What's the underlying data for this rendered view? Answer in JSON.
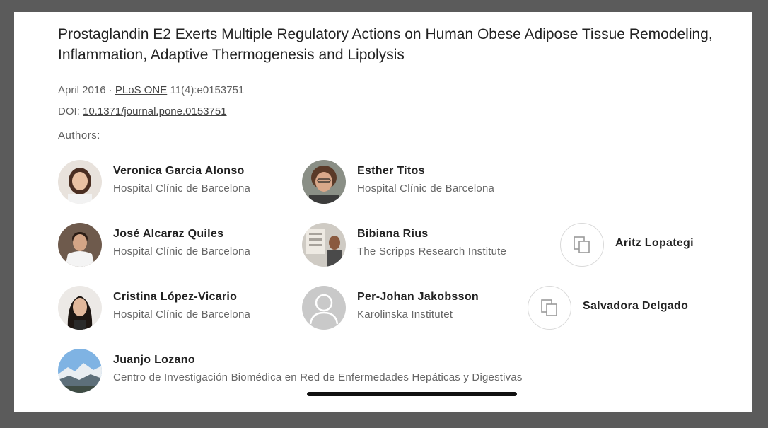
{
  "paper": {
    "title": "Prostaglandin E2 Exerts Multiple Regulatory Actions on Human Obese Adipose Tissue Remodeling, Inflammation, Adaptive Thermogenesis and Lipolysis",
    "date": "April 2016",
    "separator": "·",
    "journal": "PLoS ONE",
    "volume": "11(4):e0153751",
    "doi_label": "DOI:",
    "doi": "10.1371/journal.pone.0153751",
    "authors_label": "Authors:"
  },
  "authors": [
    {
      "name": "Veronica Garcia Alonso",
      "institution": "Hospital Clínic de Barcelona",
      "avatar": "photo"
    },
    {
      "name": "Esther Titos",
      "institution": "Hospital Clínic de Barcelona",
      "avatar": "photo"
    },
    {
      "name": "José Alcaraz Quiles",
      "institution": "Hospital Clínic de Barcelona",
      "avatar": "photo"
    },
    {
      "name": "Bibiana Rius",
      "institution": "The Scripps Research Institute",
      "avatar": "photo"
    },
    {
      "name": "Aritz Lopategi",
      "institution": "",
      "avatar": "copy-icon"
    },
    {
      "name": "Cristina López-Vicario",
      "institution": "Hospital Clínic de Barcelona",
      "avatar": "photo"
    },
    {
      "name": "Per-Johan Jakobsson",
      "institution": "Karolinska Institutet",
      "avatar": "person-silhouette-icon"
    },
    {
      "name": "Salvadora Delgado",
      "institution": "",
      "avatar": "copy-icon"
    },
    {
      "name": "Juanjo Lozano",
      "institution": "Centro de Investigación Biomédica en Red de Enfermedades Hepáticas y Digestivas",
      "avatar": "photo"
    }
  ]
}
